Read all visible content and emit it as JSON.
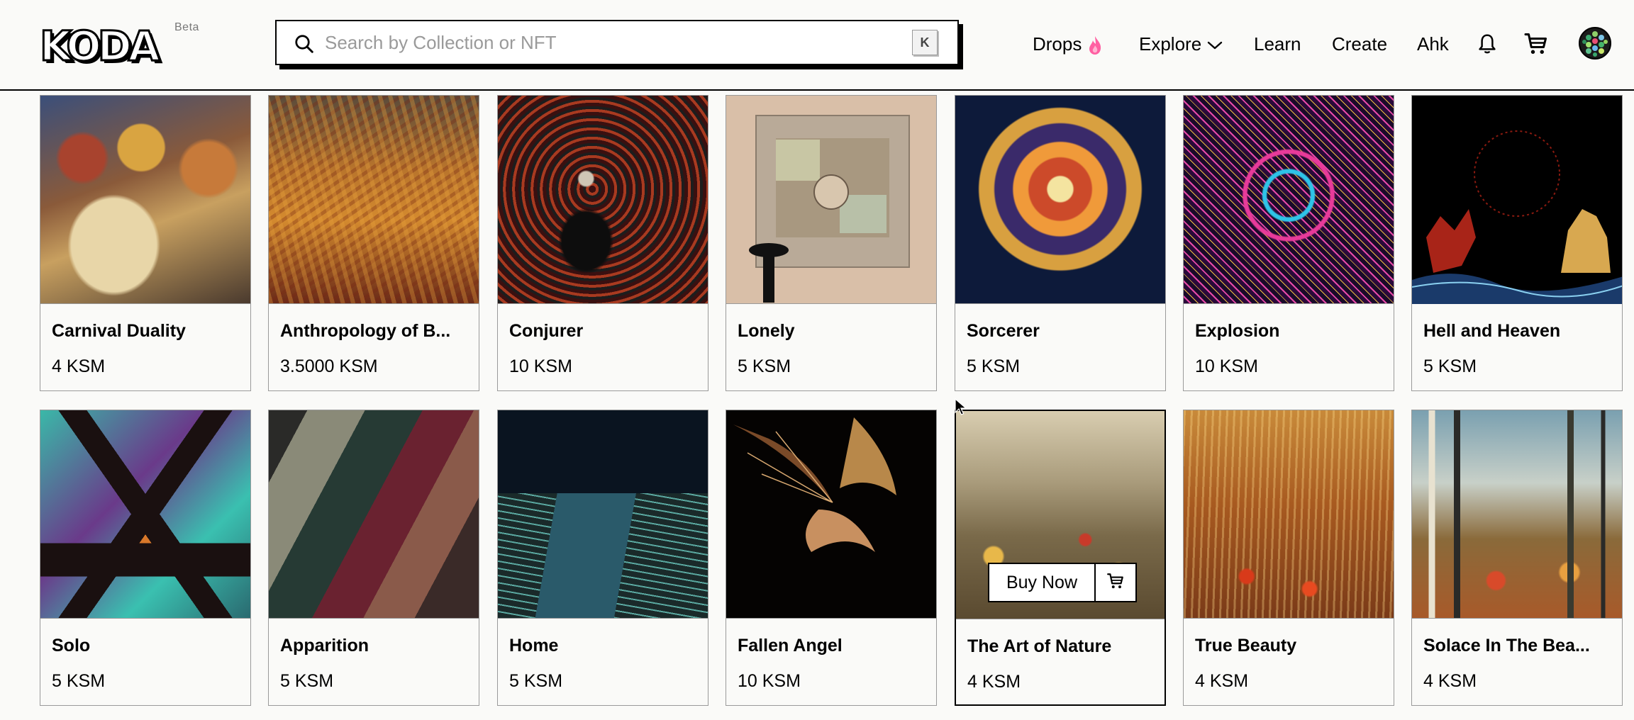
{
  "header": {
    "logo_text": "KODA",
    "beta_label": "Beta",
    "search": {
      "placeholder": "Search by Collection or NFT",
      "shortcut": "K"
    },
    "nav": {
      "drops": "Drops",
      "explore": "Explore",
      "learn": "Learn",
      "create": "Create",
      "language": "Ahk"
    },
    "icons": [
      "search-icon",
      "flame-icon",
      "chevron-down-icon",
      "bell-icon",
      "cart-icon",
      "avatar"
    ]
  },
  "colors": {
    "accent_flame": "#ff5fa2",
    "border": "#000000",
    "card_border": "#9a9a9a"
  },
  "grid": {
    "row1": [
      {
        "name": "Carnival Duality",
        "price": "4 KSM"
      },
      {
        "name": "Anthropology of B...",
        "price": "3.5000 KSM"
      },
      {
        "name": "Conjurer",
        "price": "10 KSM"
      },
      {
        "name": "Lonely",
        "price": "5 KSM"
      },
      {
        "name": "Sorcerer",
        "price": "5 KSM"
      },
      {
        "name": "Explosion",
        "price": "10 KSM"
      },
      {
        "name": "Hell and Heaven",
        "price": "5 KSM"
      }
    ],
    "row2": [
      {
        "name": "Solo",
        "price": "5 KSM"
      },
      {
        "name": "Apparition",
        "price": "5 KSM"
      },
      {
        "name": "Home",
        "price": "5 KSM"
      },
      {
        "name": "Fallen Angel",
        "price": "10 KSM"
      },
      {
        "name": "The Art of Nature",
        "price": "4 KSM"
      },
      {
        "name": "True Beauty",
        "price": "4 KSM"
      },
      {
        "name": "Solace In The Bea...",
        "price": "4 KSM"
      }
    ],
    "hover_actions": {
      "buy_now_label": "Buy Now"
    }
  }
}
